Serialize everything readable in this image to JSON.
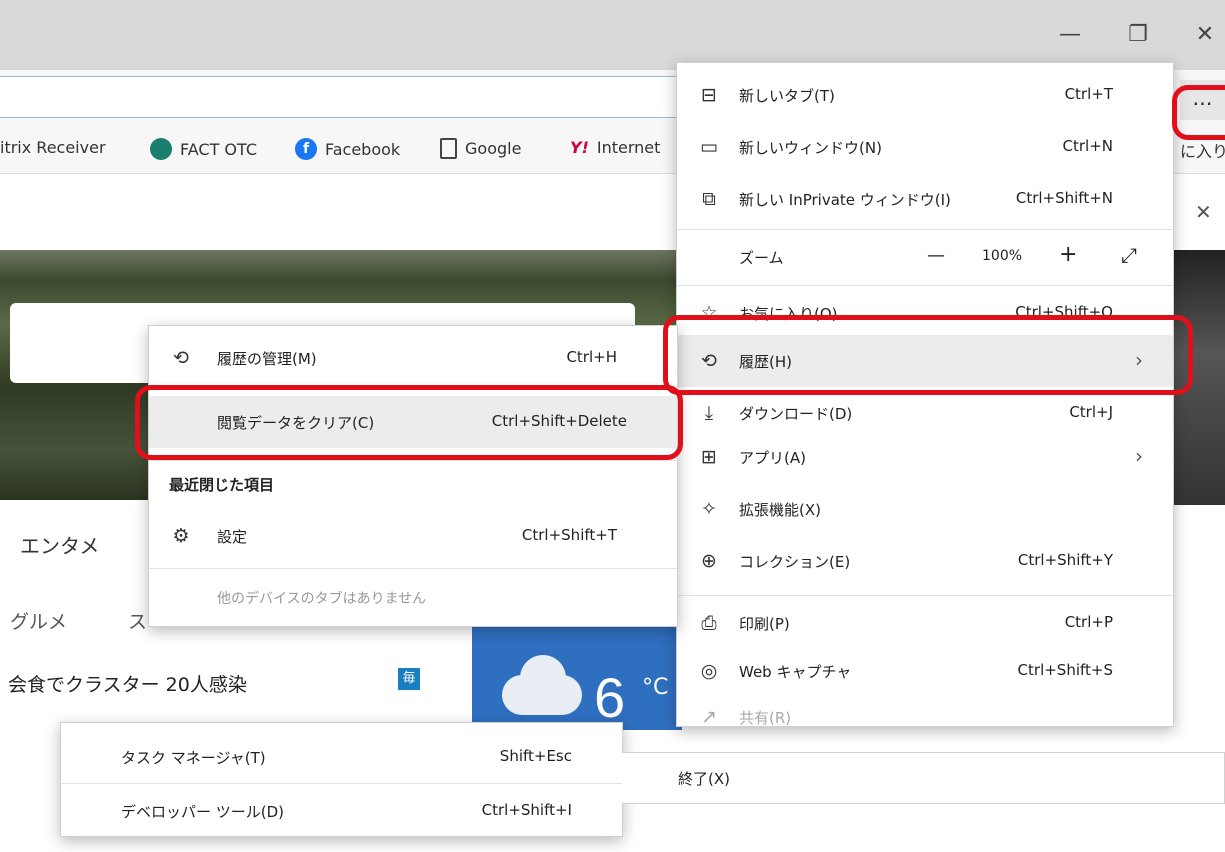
{
  "window": {
    "minimize_glyph": "—",
    "restore_glyph": "❐",
    "close_glyph": "✕",
    "more_button": "…",
    "tab_close": "✕"
  },
  "bookmarks": [
    {
      "label": "itrix Receiver"
    },
    {
      "label": "FACT OTC",
      "icon": "fact-otc-icon",
      "color": "#1a7f6e"
    },
    {
      "label": "Facebook",
      "icon": "facebook-icon",
      "color": "#1877f2"
    },
    {
      "label": "Google",
      "icon": "page-icon"
    },
    {
      "label": "Internet",
      "icon": "yahoo-icon",
      "color": "#d4004c"
    },
    {
      "label": "に入り"
    }
  ],
  "page": {
    "nav_entertainment": "エンタメ",
    "nav_gourmet": "グルメ",
    "nav_partial": "ス",
    "headline": "会食でクラスター 20人感染",
    "news_badge": "毎",
    "weather_temp": "6",
    "weather_unit": "°C"
  },
  "main_menu": {
    "items": [
      {
        "label": "新しいタブ(T)",
        "shortcut": "Ctrl+T",
        "icon": "new-tab-icon"
      },
      {
        "label": "新しいウィンドウ(N)",
        "shortcut": "Ctrl+N",
        "icon": "new-window-icon"
      },
      {
        "label": "新しい InPrivate ウィンドウ(I)",
        "shortcut": "Ctrl+Shift+N",
        "icon": "inprivate-icon"
      },
      {
        "label": "お気に入り(O)",
        "shortcut": "Ctrl+Shift+O",
        "icon": "favorites-icon"
      },
      {
        "label": "履歴(H)",
        "shortcut": "",
        "icon": "history-icon"
      },
      {
        "label": "ダウンロード(D)",
        "shortcut": "Ctrl+J",
        "icon": "download-icon"
      },
      {
        "label": "アプリ(A)",
        "shortcut": "",
        "icon": "apps-icon"
      },
      {
        "label": "拡張機能(X)",
        "shortcut": "",
        "icon": "extensions-icon"
      },
      {
        "label": "コレクション(E)",
        "shortcut": "Ctrl+Shift+Y",
        "icon": "collections-icon"
      },
      {
        "label": "印刷(P)",
        "shortcut": "Ctrl+P",
        "icon": "print-icon"
      },
      {
        "label": "Web キャプチャ",
        "shortcut": "Ctrl+Shift+S",
        "icon": "web-capture-icon"
      },
      {
        "label": "共有(R)",
        "shortcut": "",
        "icon": "share-icon"
      }
    ],
    "zoom": {
      "label": "ズーム",
      "minus": "—",
      "value": "100%",
      "plus": "+",
      "fullscreen": "⤢"
    }
  },
  "history_submenu": {
    "manage": {
      "label": "履歴の管理(M)",
      "shortcut": "Ctrl+H"
    },
    "clear": {
      "label": "閲覧データをクリア(C)",
      "shortcut": "Ctrl+Shift+Delete"
    },
    "recently_closed_header": "最近閉じた項目",
    "settings": {
      "label": "設定",
      "shortcut": "Ctrl+Shift+T"
    },
    "no_tabs": "他のデバイスのタブはありません"
  },
  "more_tools": {
    "task_manager": {
      "label": "タスク マネージャ(T)",
      "shortcut": "Shift+Esc"
    },
    "dev_tools": {
      "label": "デベロッパー ツール(D)",
      "shortcut": "Ctrl+Shift+I"
    }
  },
  "exit_label": "終了(X)",
  "colors": {
    "highlight_red": "#e0101a",
    "weather_blue": "#2f6fc0"
  }
}
